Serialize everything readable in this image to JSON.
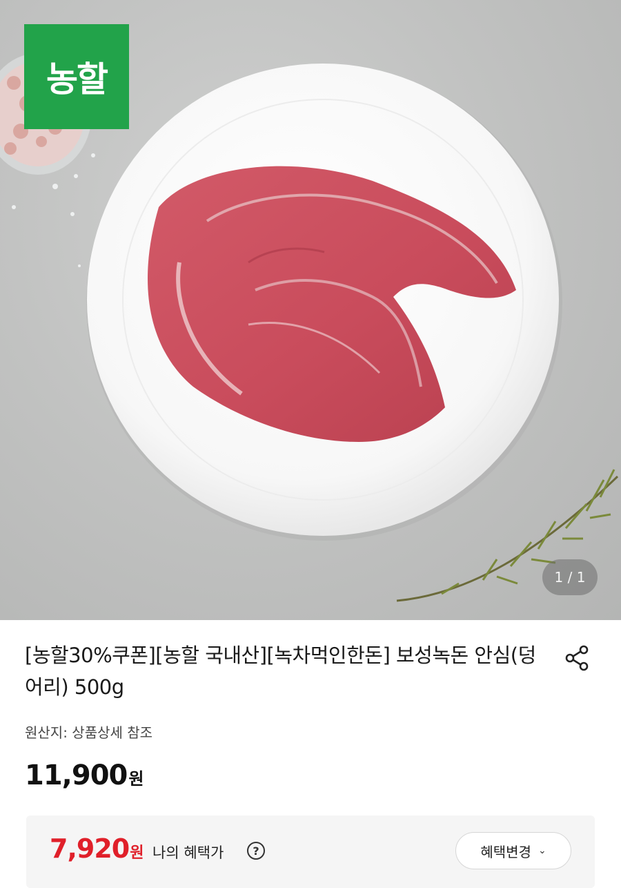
{
  "gallery": {
    "brand_logo_text": "농할",
    "brand_logo_color": "#22a34a",
    "counter": "1 / 1"
  },
  "product": {
    "title": "[농할30%쿠폰][농할 국내산][녹차먹인한돈] 보성녹돈 안심(덩어리) 500g",
    "origin": "원산지: 상품상세 참조",
    "price_value": "11,900",
    "price_unit": "원",
    "share_icon": "share-icon"
  },
  "benefit": {
    "price_value": "7,920",
    "price_unit": "원",
    "label": "나의 혜택가",
    "help_icon": "question-circle-icon",
    "help_glyph": "?",
    "change_button": "혜택변경",
    "change_chevron": "⌄",
    "accent_color": "#e0202a"
  }
}
